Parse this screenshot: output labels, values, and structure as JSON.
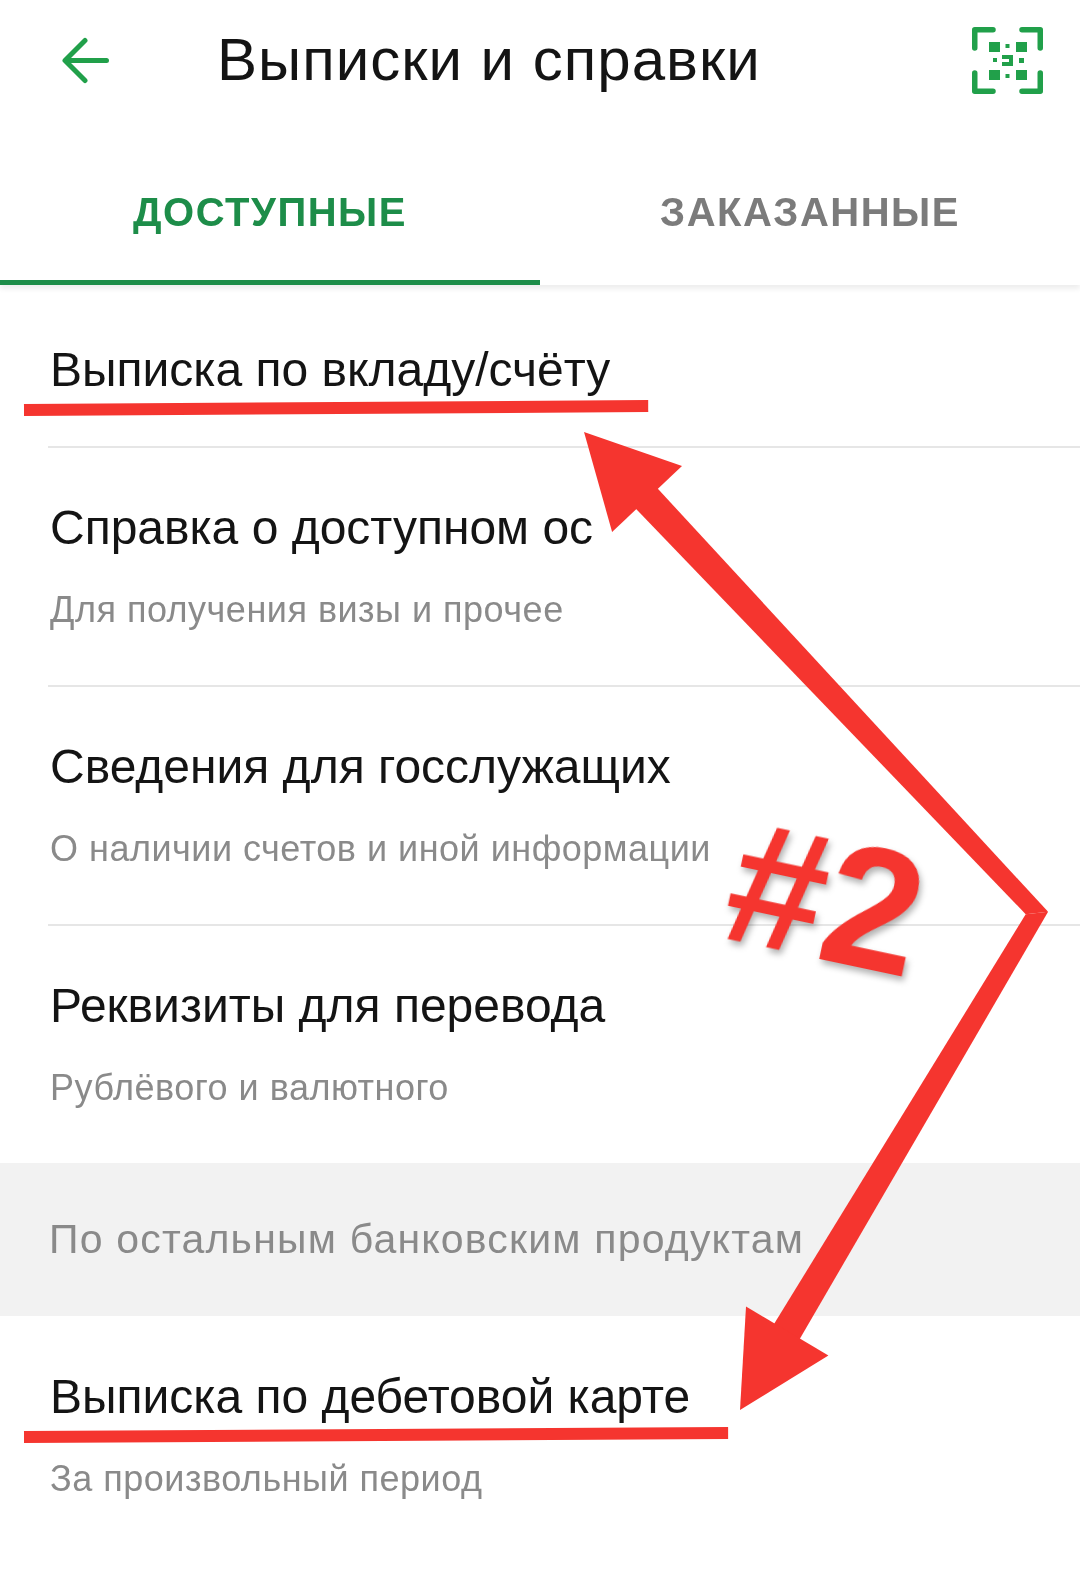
{
  "header": {
    "title": "Выписки и справки"
  },
  "tabs": [
    {
      "label": "ДОСТУПНЫЕ",
      "selected": true
    },
    {
      "label": "ЗАКАЗАННЫЕ",
      "selected": false
    }
  ],
  "items": [
    {
      "kind": "row",
      "title": "Выписка по вкладу/счёту",
      "underlined": true
    },
    {
      "kind": "row",
      "title": "Справка о доступном ос",
      "subtitle": "Для получения визы и прочее",
      "underlined": false
    },
    {
      "kind": "row",
      "title": "Сведения для госслужащих",
      "subtitle": "О наличии счетов и иной информации",
      "underlined": false
    },
    {
      "kind": "row",
      "title": "Реквизиты для перевода",
      "subtitle": "Рублёвого и валютного",
      "underlined": false
    },
    {
      "kind": "section",
      "title": "По остальным банковским продуктам"
    },
    {
      "kind": "row",
      "title": "Выписка по дебетовой карте",
      "subtitle": "За произвольный период",
      "underlined": true
    }
  ],
  "annotation": {
    "label": "#2"
  }
}
